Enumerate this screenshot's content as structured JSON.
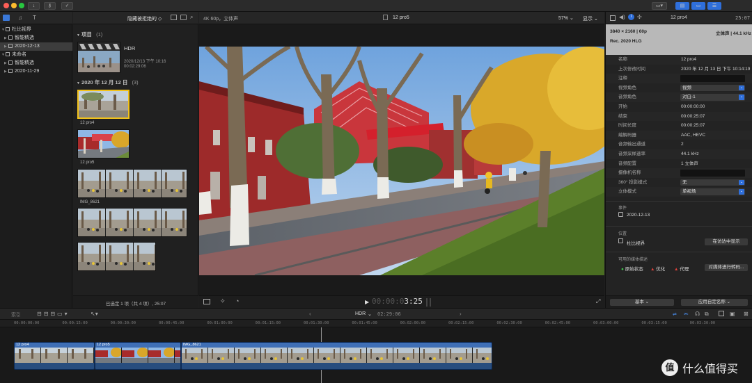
{
  "toolbar": {
    "left_icons": [
      "download-icon",
      "key-icon",
      "check-icon"
    ],
    "right_icons": [
      "workspace-icon",
      "layout-icon-1",
      "layout-icon-2",
      "layout-icon-3"
    ]
  },
  "sidebar": {
    "items": [
      {
        "label": "杜比视界",
        "level": 0,
        "selected": false
      },
      {
        "label": "智能精选",
        "level": 1,
        "selected": false
      },
      {
        "label": "2020-12-13",
        "level": 1,
        "selected": true
      },
      {
        "label": "未命名",
        "level": 0,
        "selected": false
      },
      {
        "label": "智能精选",
        "level": 1,
        "selected": false
      },
      {
        "label": "2020-11-29",
        "level": 1,
        "selected": false
      }
    ]
  },
  "browser": {
    "filter": "隐藏被拒绝的 ◇",
    "projects_header": "项目",
    "projects_count": "(1)",
    "project": {
      "name": "HDR",
      "date": "2020/12/13 下午 10:16",
      "duration": "00:02:29:06"
    },
    "date_header": "2020 年 12 月 12 日",
    "date_count": "(3)",
    "clips": [
      {
        "name": "12 pro4"
      },
      {
        "name": "12 pro5"
      },
      {
        "name": "IMG_8621"
      },
      {
        "name": ""
      },
      {
        "name": ""
      }
    ],
    "status": "已选定 1 项（共 4 项）, 25:07"
  },
  "viewer": {
    "format": "4K 60p，立体声",
    "clip_title": "12 pro5",
    "zoom": "57% ⌄",
    "display": "显示 ⌄",
    "timecode_prefix": "00:00:0",
    "timecode": "3:25"
  },
  "inspector": {
    "clip_title": "12 pro4",
    "duration": "25:07",
    "header": {
      "resolution": "3840 × 2160 | 60p",
      "audio": "立体声 | 44.1 kHz",
      "color": "Rec. 2020 HLG"
    },
    "props": [
      {
        "k": "名称",
        "v": "12 pro4",
        "type": "text"
      },
      {
        "k": "上次修改时间",
        "v": "2020 年 12 月 13 日 下午 10:14:19",
        "type": "text"
      },
      {
        "k": "注释",
        "v": "",
        "type": "field"
      },
      {
        "k": "视频角色",
        "v": "视频",
        "type": "popup"
      },
      {
        "k": "音频角色",
        "v": "对白-1",
        "type": "popup"
      },
      {
        "k": "开始",
        "v": "00:00:00:00",
        "type": "text"
      },
      {
        "k": "结束",
        "v": "00:00:25:07",
        "type": "text"
      },
      {
        "k": "时间长度",
        "v": "00:00:25:07",
        "type": "text"
      },
      {
        "k": "编解码器",
        "v": "AAC, HEVC",
        "type": "text"
      },
      {
        "k": "音频输出通道",
        "v": "2",
        "type": "text"
      },
      {
        "k": "音频采样速率",
        "v": "44.1 kHz",
        "type": "text"
      },
      {
        "k": "音频配置",
        "v": "1 立体声",
        "type": "text"
      },
      {
        "k": "摄像机名称",
        "v": "",
        "type": "field"
      },
      {
        "k": "360° 投影模式",
        "v": "无",
        "type": "popup"
      },
      {
        "k": "立体模式",
        "v": "单视场",
        "type": "popup"
      }
    ],
    "event_label": "事件",
    "event_value": "2020-12-13",
    "location_label": "位置",
    "location_value": "杜比视界",
    "show_in_finder": "在访达中显示",
    "media_label": "可用的媒体描述",
    "media_original": "原始状态",
    "media_optimized": "优化",
    "media_proxy": "代理",
    "transcode": "对媒体进行转码...",
    "basic": "基本 ⌄",
    "apply_names": "应用自定名称 ⌄"
  },
  "timeline": {
    "index_label": "索引",
    "project_name": "HDR",
    "project_duration": "02:29:06",
    "ruler": [
      "00:00:00:00",
      "00:00:15:00",
      "00:00:30:00",
      "00:00:45:00",
      "00:01:00:00",
      "00:01:15:00",
      "00:01:30:00",
      "00:01:45:00",
      "00:02:00:00",
      "00:02:15:00",
      "00:02:30:00",
      "00:02:45:00",
      "00:03:00:00",
      "00:03:15:00",
      "00:03:30:00"
    ],
    "clips": [
      {
        "name": "12 pro4"
      },
      {
        "name": "12 pro5"
      },
      {
        "name": "IMG_8621"
      }
    ]
  },
  "watermark": {
    "text": "什么值得买",
    "badge": "值"
  },
  "colors": {
    "accent": "#2f6fdb",
    "clip_blue": "#3f6fb6",
    "selection_yellow": "#f2c21a"
  }
}
